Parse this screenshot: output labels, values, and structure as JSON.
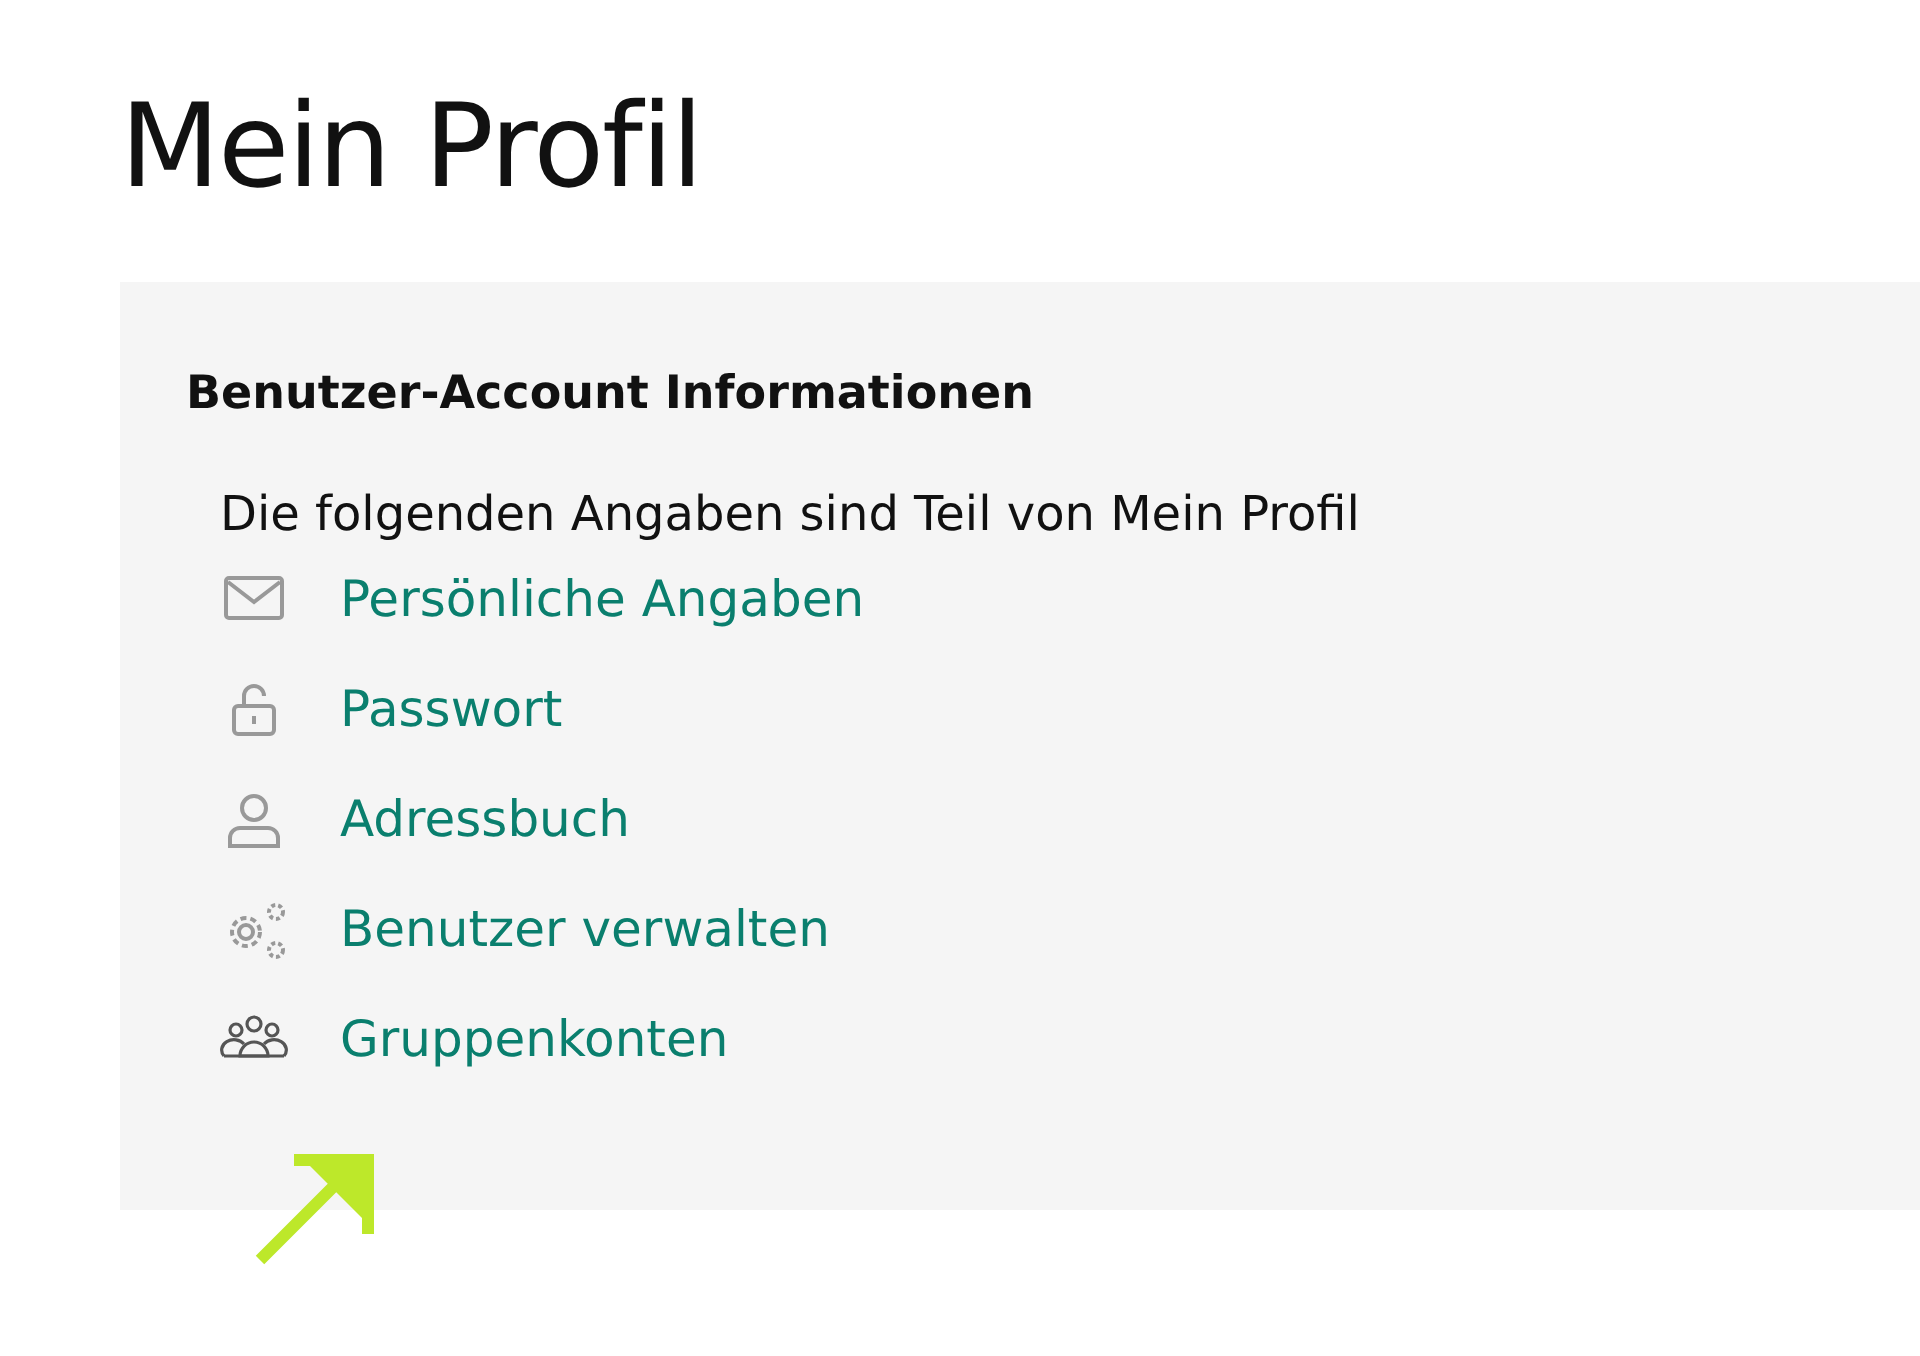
{
  "page": {
    "title": "Mein Profil"
  },
  "panel": {
    "heading": "Benutzer-Account Informationen",
    "intro": "Die folgenden Angaben sind Teil von Mein Profil",
    "links": [
      {
        "label": "Persönliche Angaben",
        "kind": "mail"
      },
      {
        "label": "Passwort",
        "kind": "lock"
      },
      {
        "label": "Adressbuch",
        "kind": "person"
      },
      {
        "label": "Benutzer verwalten",
        "kind": "gears"
      },
      {
        "label": "Gruppenkonten",
        "kind": "group"
      }
    ]
  }
}
